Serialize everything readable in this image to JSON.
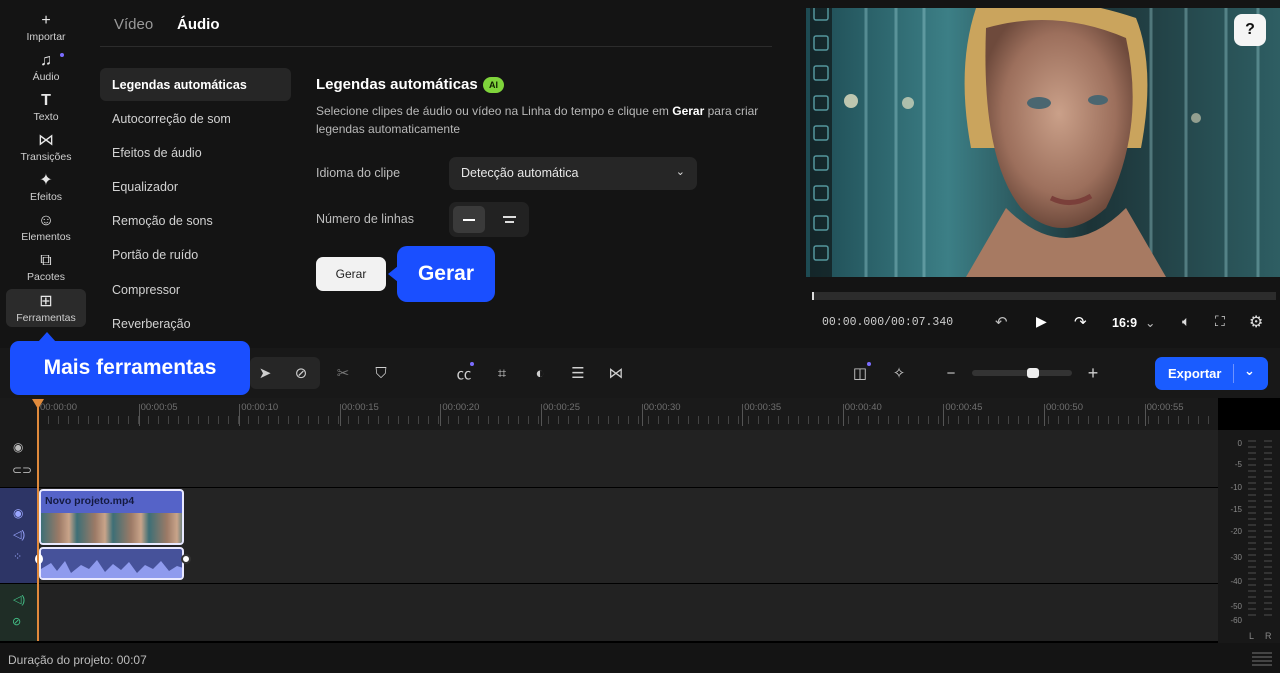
{
  "rail": {
    "items": [
      {
        "icon": "+",
        "label": "Importar"
      },
      {
        "icon": "♫",
        "label": "Áudio"
      },
      {
        "icon": "T",
        "label": "Texto"
      },
      {
        "icon": "⋈",
        "label": "Transições"
      },
      {
        "icon": "✦",
        "label": "Efeitos"
      },
      {
        "icon": "☺",
        "label": "Elementos"
      },
      {
        "icon": "⧉",
        "label": "Pacotes"
      },
      {
        "icon": "⊞",
        "label": "Ferramentas"
      }
    ]
  },
  "panel": {
    "tabs": [
      "Vídeo",
      "Áudio"
    ],
    "menu": [
      "Legendas automáticas",
      "Autocorreção de som",
      "Efeitos de áudio",
      "Equalizador",
      "Remoção de sons",
      "Portão de ruído",
      "Compressor",
      "Reverberação"
    ],
    "heading": "Legendas automáticas",
    "ai_badge": "AI",
    "desc_pre": "Selecione clipes de áudio ou vídeo na Linha do tempo e clique em ",
    "desc_bold": "Gerar",
    "desc_post": " para criar legendas automaticamente",
    "clip_language_label": "Idioma do clipe",
    "clip_language_value": "Detecção automática",
    "lines_label": "Número de linhas",
    "generate_button": "Gerar"
  },
  "callouts": {
    "gerar": "Gerar",
    "more_tools": "Mais ferramentas"
  },
  "preview": {
    "timecode": "00:00.000/00:07.340",
    "aspect": "16:9"
  },
  "toolbar": {
    "export_label": "Exportar"
  },
  "timeline": {
    "ticks": [
      "00:00:00",
      "00:00:05",
      "00:00:10",
      "00:00:15",
      "00:00:20",
      "00:00:25",
      "00:00:30",
      "00:00:35",
      "00:00:40",
      "00:00:45",
      "00:00:50",
      "00:00:55"
    ],
    "clip_name": "Novo projeto.mp4",
    "meter_scale": [
      "0",
      "-5",
      "-10",
      "-15",
      "-20",
      "-30",
      "-40",
      "-50",
      "-60"
    ],
    "meter_channels": [
      "L",
      "R"
    ]
  },
  "status": {
    "duration": "Duração do projeto: 00:07"
  },
  "colors": {
    "accent": "#1a5cff",
    "clip": "#5563c8",
    "ai_badge": "#7fd43b"
  }
}
